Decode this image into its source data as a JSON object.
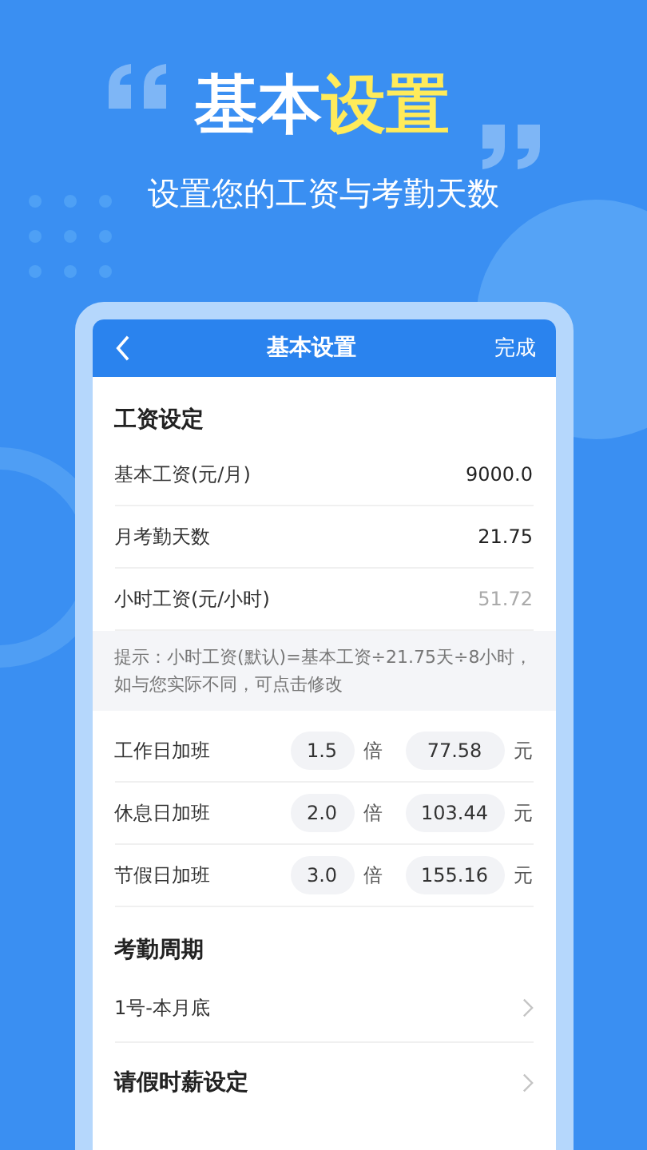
{
  "headline": {
    "parts": [
      {
        "text": "基本",
        "highlight": false
      },
      {
        "text": "设置",
        "highlight": true
      }
    ]
  },
  "subtitle": "设置您的工资与考勤天数",
  "app": {
    "nav": {
      "title": "基本设置",
      "action": "完成"
    },
    "rows": [
      {
        "kind": "heading",
        "label": "工资设定"
      },
      {
        "kind": "value",
        "label": "基本工资(元/月)",
        "value": "9000.0",
        "muted": false
      },
      {
        "kind": "value",
        "label": "月考勤天数",
        "value": "21.75",
        "muted": false
      },
      {
        "kind": "value",
        "label": "小时工资(元/小时)",
        "value": "51.72",
        "muted": true
      },
      {
        "kind": "hint",
        "text": "提示：小时工资(默认)=基本工资÷21.75天÷8小时，如与您实际不同，可点击修改"
      },
      {
        "kind": "overtime",
        "label": "工作日加班",
        "rate": "1.5",
        "rate_unit": "倍",
        "amount": "77.58",
        "amount_unit": "元"
      },
      {
        "kind": "overtime",
        "label": "休息日加班",
        "rate": "2.0",
        "rate_unit": "倍",
        "amount": "103.44",
        "amount_unit": "元"
      },
      {
        "kind": "overtime",
        "label": "节假日加班",
        "rate": "3.0",
        "rate_unit": "倍",
        "amount": "155.16",
        "amount_unit": "元"
      },
      {
        "kind": "heading",
        "label": "考勤周期"
      },
      {
        "kind": "link",
        "label": "1号-本月底"
      },
      {
        "kind": "link-heading",
        "label": "请假时薪设定"
      }
    ]
  }
}
